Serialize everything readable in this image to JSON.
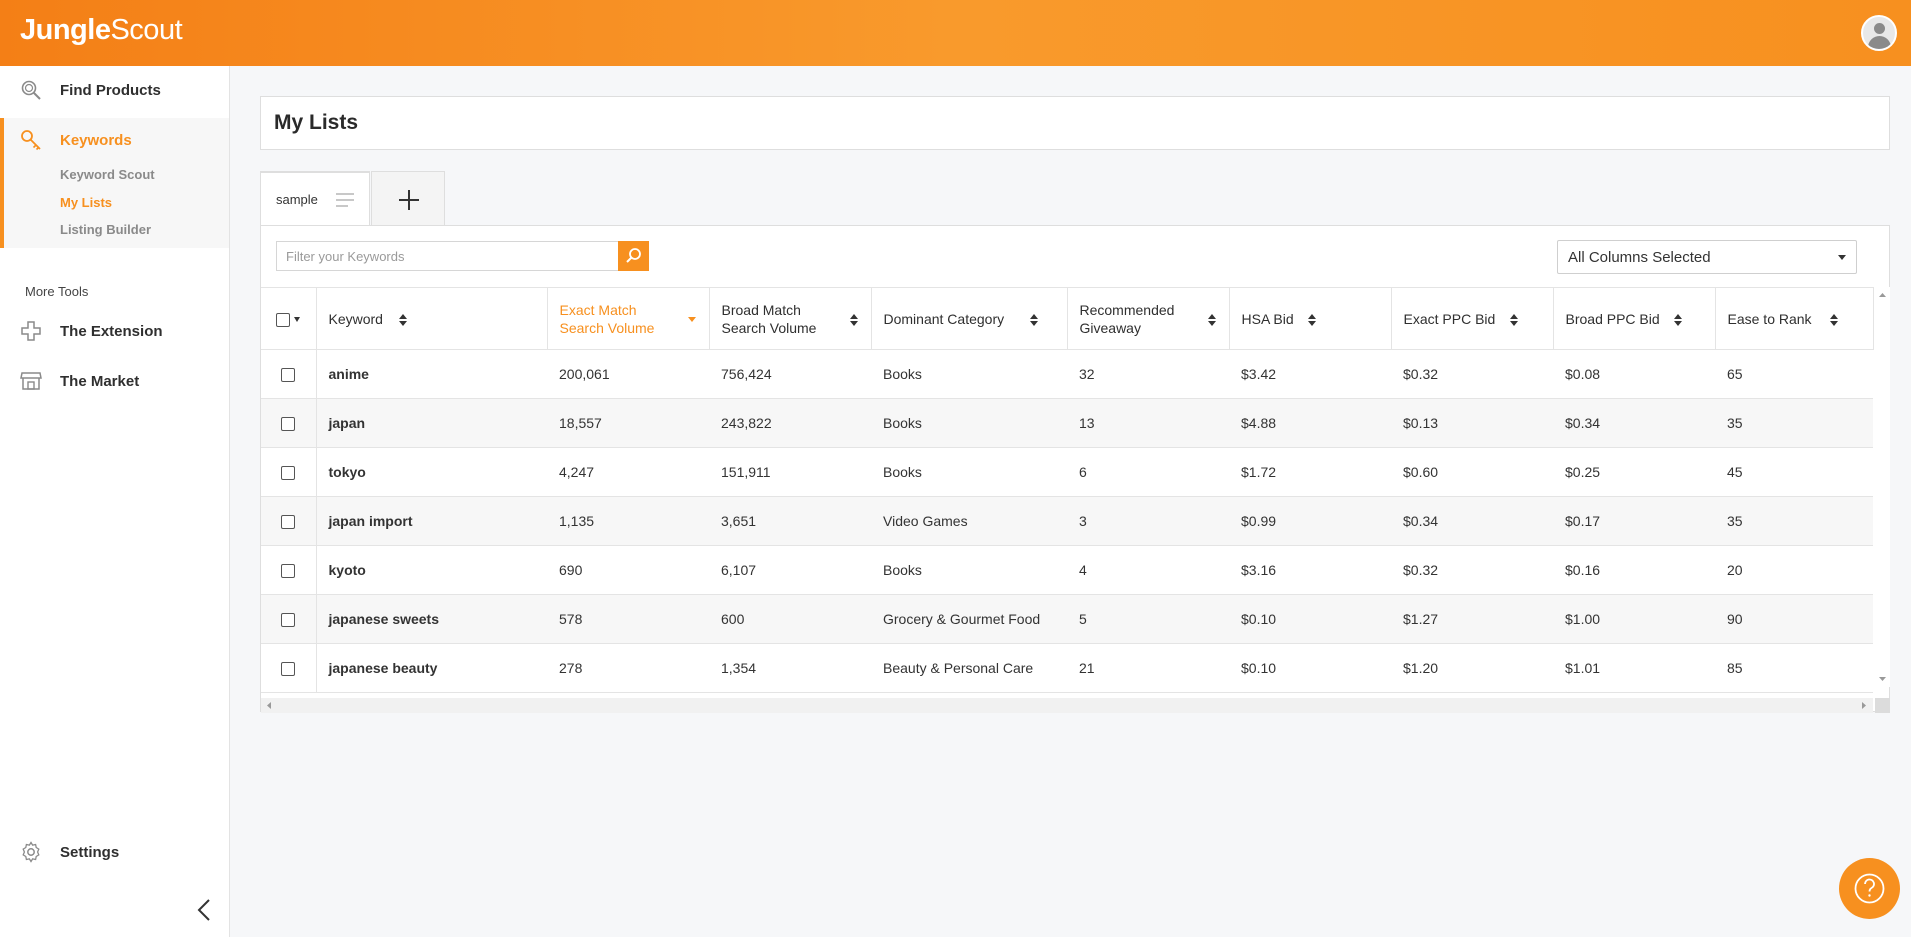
{
  "header": {
    "logo_part1": "Jungle",
    "logo_part2": "Scout"
  },
  "sidebar": {
    "find_products": "Find Products",
    "keywords": "Keywords",
    "keyword_sub": [
      "Keyword Scout",
      "My Lists",
      "Listing Builder"
    ],
    "active_sub": "My Lists",
    "more_tools": "More Tools",
    "extension": "The Extension",
    "market": "The Market",
    "settings": "Settings"
  },
  "page": {
    "title": "My Lists"
  },
  "tabs": {
    "active": "sample"
  },
  "filter": {
    "placeholder": "Filter your Keywords",
    "value": ""
  },
  "columns_select": {
    "value": "All Columns Selected"
  },
  "accent_color": "#f7901f",
  "table": {
    "headers": [
      "Keyword",
      "Exact Match Search Volume",
      "Broad Match Search Volume",
      "Dominant Category",
      "Recommended Giveaway",
      "HSA Bid",
      "Exact PPC Bid",
      "Broad PPC Bid",
      "Ease to Rank"
    ],
    "sorted_column": "Exact Match Search Volume",
    "sort_direction": "descending",
    "rows": [
      [
        "anime",
        "200,061",
        "756,424",
        "Books",
        "32",
        "$3.42",
        "$0.32",
        "$0.08",
        "65"
      ],
      [
        "japan",
        "18,557",
        "243,822",
        "Books",
        "13",
        "$4.88",
        "$0.13",
        "$0.34",
        "35"
      ],
      [
        "tokyo",
        "4,247",
        "151,911",
        "Books",
        "6",
        "$1.72",
        "$0.60",
        "$0.25",
        "45"
      ],
      [
        "japan import",
        "1,135",
        "3,651",
        "Video Games",
        "3",
        "$0.99",
        "$0.34",
        "$0.17",
        "35"
      ],
      [
        "kyoto",
        "690",
        "6,107",
        "Books",
        "4",
        "$3.16",
        "$0.32",
        "$0.16",
        "20"
      ],
      [
        "japanese sweets",
        "578",
        "600",
        "Grocery & Gourmet Food",
        "5",
        "$0.10",
        "$1.27",
        "$1.00",
        "90"
      ],
      [
        "japanese beauty",
        "278",
        "1,354",
        "Beauty & Personal Care",
        "21",
        "$0.10",
        "$1.20",
        "$1.01",
        "85"
      ]
    ]
  }
}
